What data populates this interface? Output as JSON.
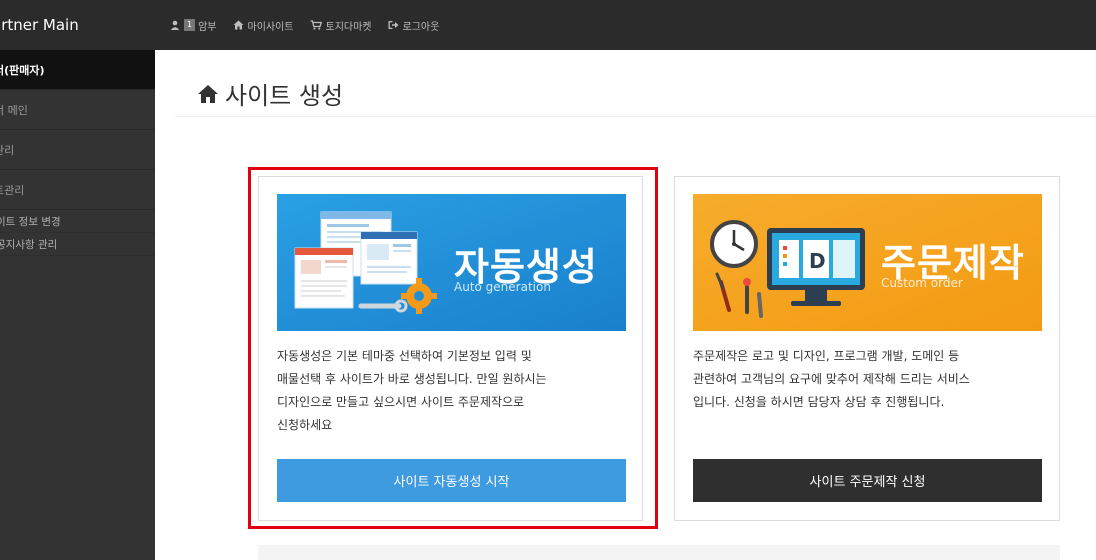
{
  "brand": {
    "title": "artner Main"
  },
  "topnav": [
    {
      "icon": "user-icon",
      "badge": "1",
      "label": "암부"
    },
    {
      "icon": "home-icon",
      "label": "마이사이트"
    },
    {
      "icon": "cart-icon",
      "label": "토지다마켓"
    },
    {
      "icon": "logout-icon",
      "label": "로그아웃"
    }
  ],
  "sidebar": {
    "items": [
      {
        "label": "너(판매자)",
        "active": true
      },
      {
        "label": "너 메인"
      },
      {
        "label": "관리"
      },
      {
        "label": "트관리"
      }
    ],
    "subitems": [
      {
        "label": "이트 정보 변경"
      },
      {
        "label": "공지사항 관리"
      }
    ]
  },
  "page": {
    "title": "사이트 생성",
    "title_icon": "home-icon"
  },
  "cards": {
    "auto": {
      "banner_title": "자동생성",
      "banner_subtitle": "Auto generation",
      "desc_lines": [
        "자동생성은 기본 테마중 선택하여 기본정보 입력 및",
        "매물선택 후 사이트가 바로 생성됩니다. 만일 원하시는",
        "디자인으로 만들고 싶으시면 사이트 주문제작으로",
        "신청하세요"
      ],
      "button": "사이트 자동생성 시작"
    },
    "custom": {
      "banner_title": "주문제작",
      "banner_subtitle": "Custom order",
      "desc_lines": [
        "주문제작은 로고 및 디자인, 프로그램 개발, 도메인 등",
        "관련하여 고객님의 요구에 맞추어 제작해 드리는 서비스",
        "입니다. 신청을 하시면 담당자 상담 후 진행됩니다."
      ],
      "button": "사이트 주문제작 신청"
    }
  },
  "colors": {
    "highlight": "#e0000e",
    "auto_banner": "#1f8fd8",
    "custom_banner": "#f5a31e",
    "auto_button": "#3e9be0",
    "custom_button": "#2f2f2f"
  }
}
